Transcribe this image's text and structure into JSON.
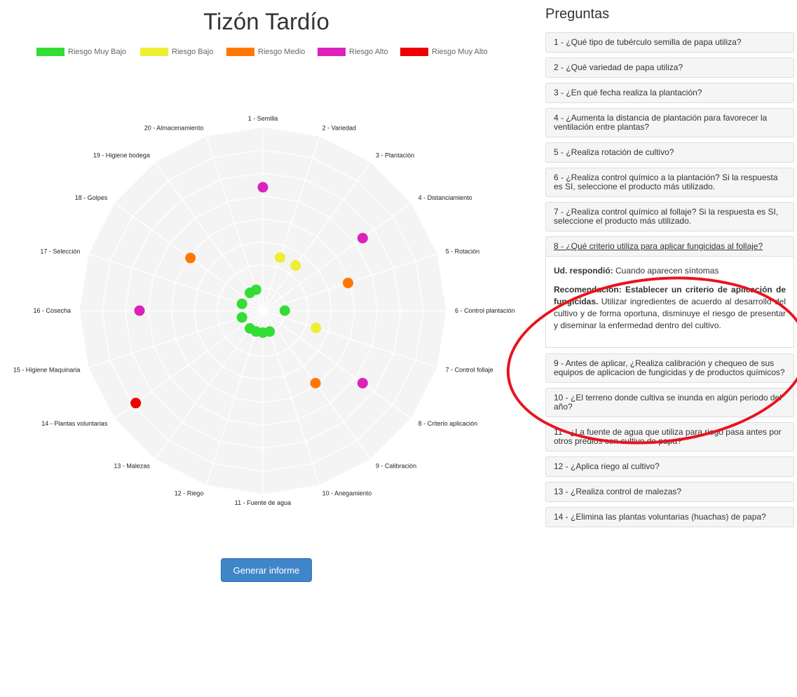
{
  "chart_title": "Tizón Tardío",
  "legend": [
    {
      "label": "Riesgo Muy Bajo",
      "color": "#33dd33"
    },
    {
      "label": "Riesgo Bajo",
      "color": "#eeee33"
    },
    {
      "label": "Riesgo Medio",
      "color": "#ff7700"
    },
    {
      "label": "Riesgo Alto",
      "color": "#dd22bb"
    },
    {
      "label": "Riesgo Muy Alto",
      "color": "#ee0000"
    }
  ],
  "chart_data": {
    "type": "scatter",
    "chart_form": "polar radar",
    "title": "Tizón Tardío",
    "axes": [
      "1 - Semilla",
      "2 - Variedad",
      "3 - Plantación",
      "4 - Distanciamiento",
      "5 - Rotación",
      "6 - Control plantación",
      "7 - Control follaje",
      "8 - Criterio aplicación",
      "9 - Calibración",
      "10 - Anegamiento",
      "11 - Fuente de agua",
      "12 - Riego",
      "13 - Malezas",
      "14 - Plantas voluntarias",
      "15 - Higiene Maquinaria",
      "16 - Cosecha",
      "17 - Selección",
      "18 - Golpes",
      "19 - Higiene bodega",
      "20 - Almacenamiento"
    ],
    "risk_scale": [
      "Riesgo Muy Bajo",
      "Riesgo Bajo",
      "Riesgo Medio",
      "Riesgo Alto",
      "Riesgo Muy Alto"
    ],
    "values": [
      4,
      2,
      2,
      4,
      3,
      1,
      2,
      4,
      3,
      1,
      1,
      1,
      1,
      5,
      1,
      4,
      1,
      3,
      1,
      1
    ],
    "range": [
      0,
      5
    ],
    "grid": true,
    "legend_position": "top"
  },
  "button_label": "Generar informe",
  "questions_title": "Preguntas",
  "questions": [
    "1 - ¿Qué tipo de tubérculo semilla de papa utiliza?",
    "2 - ¿Qué variedad de papa utiliza?",
    "3 - ¿En qué fecha realiza la plantación?",
    "4 - ¿Aumenta la distancia de plantación para favorecer la ventilación entre plantas?",
    "5 - ¿Realiza rotación de cultivo?",
    "6 - ¿Realiza control químico a la plantación? Si la respuesta es SI, seleccione el producto más utilizado.",
    "7 - ¿Realiza control químico al follaje? Si la respuesta es SI, seleccione el producto más utilizado.",
    "8 - ¿Qué criterio utiliza para aplicar fungicidas al follaje?",
    "9 - Antes de aplicar, ¿Realiza calibración y chequeo de sus equipos de aplicacion de fungicidas y de productos químicos?",
    "10 - ¿El terreno donde cultiva se inunda en algún periodo del año?",
    "11 - ¿La fuente de agua que utiliza para riego pasa antes por otros predios con cultivo de papa?",
    "12 - ¿Aplica riego al cultivo?",
    "13 - ¿Realiza control de malezas?",
    "14 - ¿Elimina las plantas voluntarias (huachas) de papa?"
  ],
  "expanded": {
    "response_label": "Ud. respondió:",
    "response_value": "Cuando aparecen síntomas",
    "recommendation_label": "Recomendación: Establecer un criterio de aplicación de fungicidas.",
    "recommendation_text": "Utilizar ingredientes de acuerdo al desarrollo del cultivo y de forma oportuna, disminuye el riesgo de presentar y diseminar la enfermedad dentro del cultivo."
  }
}
